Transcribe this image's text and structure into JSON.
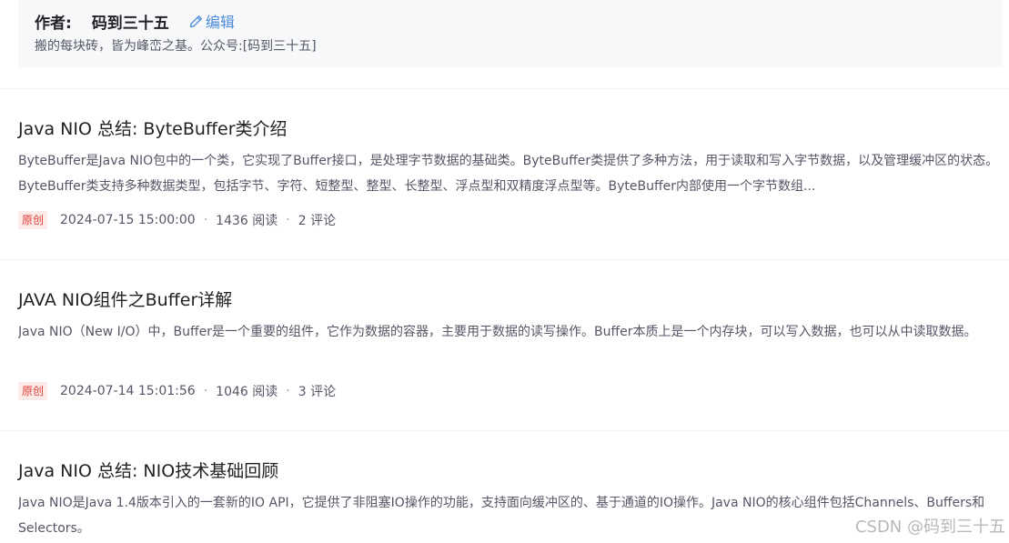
{
  "author": {
    "label": "作者:",
    "name": "码到三十五",
    "edit_label": "编辑",
    "motto": "搬的每块砖，皆为峰峦之基。公众号:[码到三十五]"
  },
  "articles": [
    {
      "title": "Java NIO 总结: ByteBuffer类介绍",
      "summary": "ByteBuffer是Java NIO包中的一个类，它实现了Buffer接口，是处理字节数据的基础类。ByteBuffer类提供了多种方法，用于读取和写入字节数据，以及管理缓冲区的状态。ByteBuffer类支持多种数据类型，包括字节、字符、短整型、整型、长整型、浮点型和双精度浮点型等。ByteBuffer内部使用一个字节数组...",
      "badge": "原创",
      "datetime": "2024-07-15 15:00:00",
      "reads": "1436 阅读",
      "comments": "2 评论"
    },
    {
      "title": "JAVA NIO组件之Buffer详解",
      "summary": "Java NIO（New I/O）中，Buffer是一个重要的组件，它作为数据的容器，主要用于数据的读写操作。Buffer本质上是一个内存块，可以写入数据，也可以从中读取数据。",
      "badge": "原创",
      "datetime": "2024-07-14 15:01:56",
      "reads": "1046 阅读",
      "comments": "3 评论"
    },
    {
      "title": "Java NIO 总结: NIO技术基础回顾",
      "summary": "Java NIO是Java 1.4版本引入的一套新的IO API，它提供了非阻塞IO操作的功能，支持面向缓冲区的、基于通道的IO操作。Java NIO的核心组件包括Channels、Buffers和Selectors。"
    }
  ],
  "meta_separator": "·",
  "watermark": "CSDN @码到三十五",
  "icons": {
    "edit": "pencil-icon"
  },
  "colors": {
    "link": "#4b8bd9",
    "badge_text": "#e33e33",
    "badge_bg": "#fbeaea"
  }
}
